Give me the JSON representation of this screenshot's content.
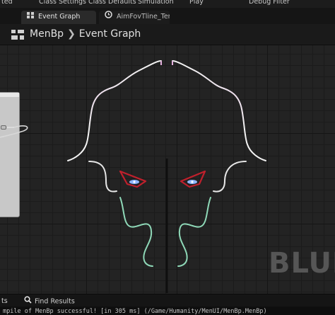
{
  "toolbar": {
    "items": [
      "ted",
      "Class Settings",
      "Class Defaults",
      "Simulation",
      "Play",
      "Debug Filter"
    ]
  },
  "tabs": [
    {
      "label": "Event Graph",
      "icon": "grid-icon",
      "active": true
    },
    {
      "label": "AimFovTline_Temp",
      "icon": "clock-icon",
      "active": false
    }
  ],
  "graph": {
    "breadcrumb": {
      "blueprint": "MenBp",
      "graph": "Event Graph"
    },
    "watermark": "BLUE"
  },
  "bottom_tabs": [
    {
      "label": "ts",
      "icon": ""
    },
    {
      "label": "Find Results",
      "icon": "search-icon"
    }
  ],
  "log": {
    "text": "mpile of MenBp successful! [in 305 ms] (/Game/Humanity/MenUI/MenBp.MenBp)"
  },
  "colors": {
    "accent_pink": "#e2a6d8",
    "accent_white": "#f0f0f0",
    "accent_green": "#8fd9b8",
    "eye_red": "#c0202c",
    "eye_blue": "#8fb6ff"
  }
}
